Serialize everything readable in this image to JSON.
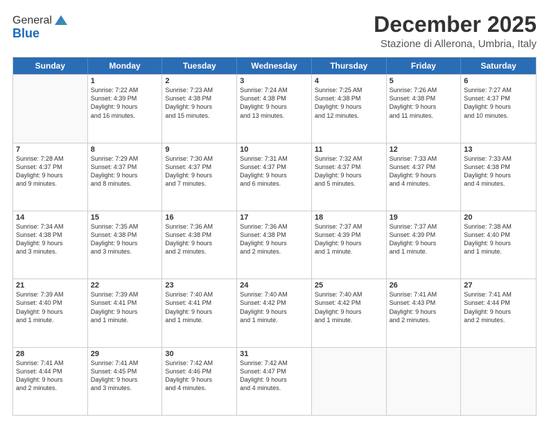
{
  "logo": {
    "general": "General",
    "blue": "Blue"
  },
  "header": {
    "month": "December 2025",
    "location": "Stazione di Allerona, Umbria, Italy"
  },
  "days": [
    "Sunday",
    "Monday",
    "Tuesday",
    "Wednesday",
    "Thursday",
    "Friday",
    "Saturday"
  ],
  "weeks": [
    [
      {
        "day": "",
        "lines": []
      },
      {
        "day": "1",
        "lines": [
          "Sunrise: 7:22 AM",
          "Sunset: 4:39 PM",
          "Daylight: 9 hours",
          "and 16 minutes."
        ]
      },
      {
        "day": "2",
        "lines": [
          "Sunrise: 7:23 AM",
          "Sunset: 4:38 PM",
          "Daylight: 9 hours",
          "and 15 minutes."
        ]
      },
      {
        "day": "3",
        "lines": [
          "Sunrise: 7:24 AM",
          "Sunset: 4:38 PM",
          "Daylight: 9 hours",
          "and 13 minutes."
        ]
      },
      {
        "day": "4",
        "lines": [
          "Sunrise: 7:25 AM",
          "Sunset: 4:38 PM",
          "Daylight: 9 hours",
          "and 12 minutes."
        ]
      },
      {
        "day": "5",
        "lines": [
          "Sunrise: 7:26 AM",
          "Sunset: 4:38 PM",
          "Daylight: 9 hours",
          "and 11 minutes."
        ]
      },
      {
        "day": "6",
        "lines": [
          "Sunrise: 7:27 AM",
          "Sunset: 4:37 PM",
          "Daylight: 9 hours",
          "and 10 minutes."
        ]
      }
    ],
    [
      {
        "day": "7",
        "lines": [
          "Sunrise: 7:28 AM",
          "Sunset: 4:37 PM",
          "Daylight: 9 hours",
          "and 9 minutes."
        ]
      },
      {
        "day": "8",
        "lines": [
          "Sunrise: 7:29 AM",
          "Sunset: 4:37 PM",
          "Daylight: 9 hours",
          "and 8 minutes."
        ]
      },
      {
        "day": "9",
        "lines": [
          "Sunrise: 7:30 AM",
          "Sunset: 4:37 PM",
          "Daylight: 9 hours",
          "and 7 minutes."
        ]
      },
      {
        "day": "10",
        "lines": [
          "Sunrise: 7:31 AM",
          "Sunset: 4:37 PM",
          "Daylight: 9 hours",
          "and 6 minutes."
        ]
      },
      {
        "day": "11",
        "lines": [
          "Sunrise: 7:32 AM",
          "Sunset: 4:37 PM",
          "Daylight: 9 hours",
          "and 5 minutes."
        ]
      },
      {
        "day": "12",
        "lines": [
          "Sunrise: 7:33 AM",
          "Sunset: 4:37 PM",
          "Daylight: 9 hours",
          "and 4 minutes."
        ]
      },
      {
        "day": "13",
        "lines": [
          "Sunrise: 7:33 AM",
          "Sunset: 4:38 PM",
          "Daylight: 9 hours",
          "and 4 minutes."
        ]
      }
    ],
    [
      {
        "day": "14",
        "lines": [
          "Sunrise: 7:34 AM",
          "Sunset: 4:38 PM",
          "Daylight: 9 hours",
          "and 3 minutes."
        ]
      },
      {
        "day": "15",
        "lines": [
          "Sunrise: 7:35 AM",
          "Sunset: 4:38 PM",
          "Daylight: 9 hours",
          "and 3 minutes."
        ]
      },
      {
        "day": "16",
        "lines": [
          "Sunrise: 7:36 AM",
          "Sunset: 4:38 PM",
          "Daylight: 9 hours",
          "and 2 minutes."
        ]
      },
      {
        "day": "17",
        "lines": [
          "Sunrise: 7:36 AM",
          "Sunset: 4:38 PM",
          "Daylight: 9 hours",
          "and 2 minutes."
        ]
      },
      {
        "day": "18",
        "lines": [
          "Sunrise: 7:37 AM",
          "Sunset: 4:39 PM",
          "Daylight: 9 hours",
          "and 1 minute."
        ]
      },
      {
        "day": "19",
        "lines": [
          "Sunrise: 7:37 AM",
          "Sunset: 4:39 PM",
          "Daylight: 9 hours",
          "and 1 minute."
        ]
      },
      {
        "day": "20",
        "lines": [
          "Sunrise: 7:38 AM",
          "Sunset: 4:40 PM",
          "Daylight: 9 hours",
          "and 1 minute."
        ]
      }
    ],
    [
      {
        "day": "21",
        "lines": [
          "Sunrise: 7:39 AM",
          "Sunset: 4:40 PM",
          "Daylight: 9 hours",
          "and 1 minute."
        ]
      },
      {
        "day": "22",
        "lines": [
          "Sunrise: 7:39 AM",
          "Sunset: 4:41 PM",
          "Daylight: 9 hours",
          "and 1 minute."
        ]
      },
      {
        "day": "23",
        "lines": [
          "Sunrise: 7:40 AM",
          "Sunset: 4:41 PM",
          "Daylight: 9 hours",
          "and 1 minute."
        ]
      },
      {
        "day": "24",
        "lines": [
          "Sunrise: 7:40 AM",
          "Sunset: 4:42 PM",
          "Daylight: 9 hours",
          "and 1 minute."
        ]
      },
      {
        "day": "25",
        "lines": [
          "Sunrise: 7:40 AM",
          "Sunset: 4:42 PM",
          "Daylight: 9 hours",
          "and 1 minute."
        ]
      },
      {
        "day": "26",
        "lines": [
          "Sunrise: 7:41 AM",
          "Sunset: 4:43 PM",
          "Daylight: 9 hours",
          "and 2 minutes."
        ]
      },
      {
        "day": "27",
        "lines": [
          "Sunrise: 7:41 AM",
          "Sunset: 4:44 PM",
          "Daylight: 9 hours",
          "and 2 minutes."
        ]
      }
    ],
    [
      {
        "day": "28",
        "lines": [
          "Sunrise: 7:41 AM",
          "Sunset: 4:44 PM",
          "Daylight: 9 hours",
          "and 2 minutes."
        ]
      },
      {
        "day": "29",
        "lines": [
          "Sunrise: 7:41 AM",
          "Sunset: 4:45 PM",
          "Daylight: 9 hours",
          "and 3 minutes."
        ]
      },
      {
        "day": "30",
        "lines": [
          "Sunrise: 7:42 AM",
          "Sunset: 4:46 PM",
          "Daylight: 9 hours",
          "and 4 minutes."
        ]
      },
      {
        "day": "31",
        "lines": [
          "Sunrise: 7:42 AM",
          "Sunset: 4:47 PM",
          "Daylight: 9 hours",
          "and 4 minutes."
        ]
      },
      {
        "day": "",
        "lines": []
      },
      {
        "day": "",
        "lines": []
      },
      {
        "day": "",
        "lines": []
      }
    ]
  ]
}
